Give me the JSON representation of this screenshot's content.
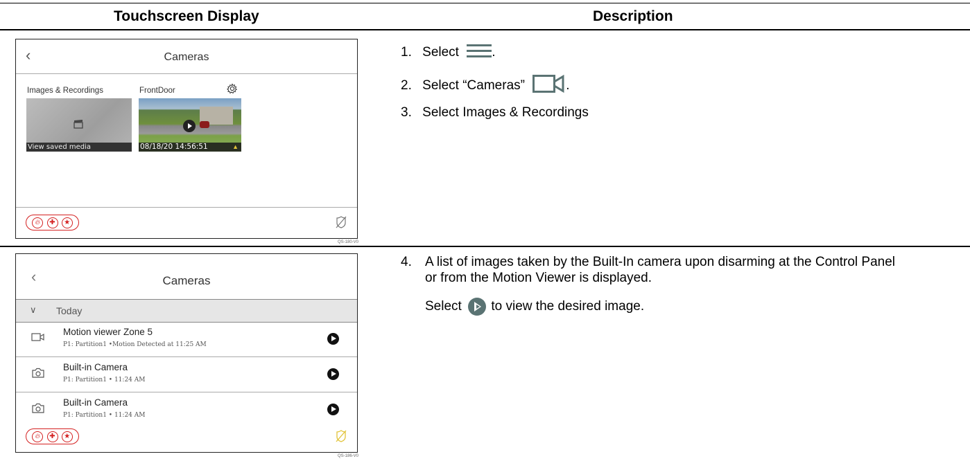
{
  "table": {
    "col1_header": "Touchscreen Display",
    "col2_header": "Description"
  },
  "screen1": {
    "title": "Cameras",
    "tile1_label": "Images & Recordings",
    "tile1_caption": "View saved media",
    "tile2_label": "FrontDoor",
    "tile2_timestamp": "08/18/20 14:56:51",
    "code": "QS-180-V0"
  },
  "screen2": {
    "title": "Cameras",
    "group": "Today",
    "rows": [
      {
        "title": "Motion viewer Zone 5",
        "sub": "P1: Partition1 •Motion Detected at 11:25 AM",
        "icon": "video-camera-icon"
      },
      {
        "title": "Built-in Camera",
        "sub": "P1: Partition1 • 11:24 AM",
        "icon": "photo-camera-icon"
      },
      {
        "title": "Built-in Camera",
        "sub": "P1: Partition1 • 11:24 AM",
        "icon": "photo-camera-icon"
      }
    ],
    "code": "QS-186-V0"
  },
  "steps": {
    "step1_num": "1.",
    "step1_text": "Select",
    "step1_end": ".",
    "step2_num": "2.",
    "step2_text": "Select “Cameras”",
    "step2_end": ".",
    "step3_num": "3.",
    "step3_text": "Select Images & Recordings",
    "step4_num": "4.",
    "step4_text": "A list of images taken by the Built-In camera upon disarming at the Control Panel or from the Motion Viewer is displayed.",
    "step4b_pre": "Select",
    "step4b_post": "to view the desired image."
  },
  "colors": {
    "emergency": "#d42020",
    "icon_teal": "#5a7373",
    "bypass_yellow": "#e2c43a"
  }
}
